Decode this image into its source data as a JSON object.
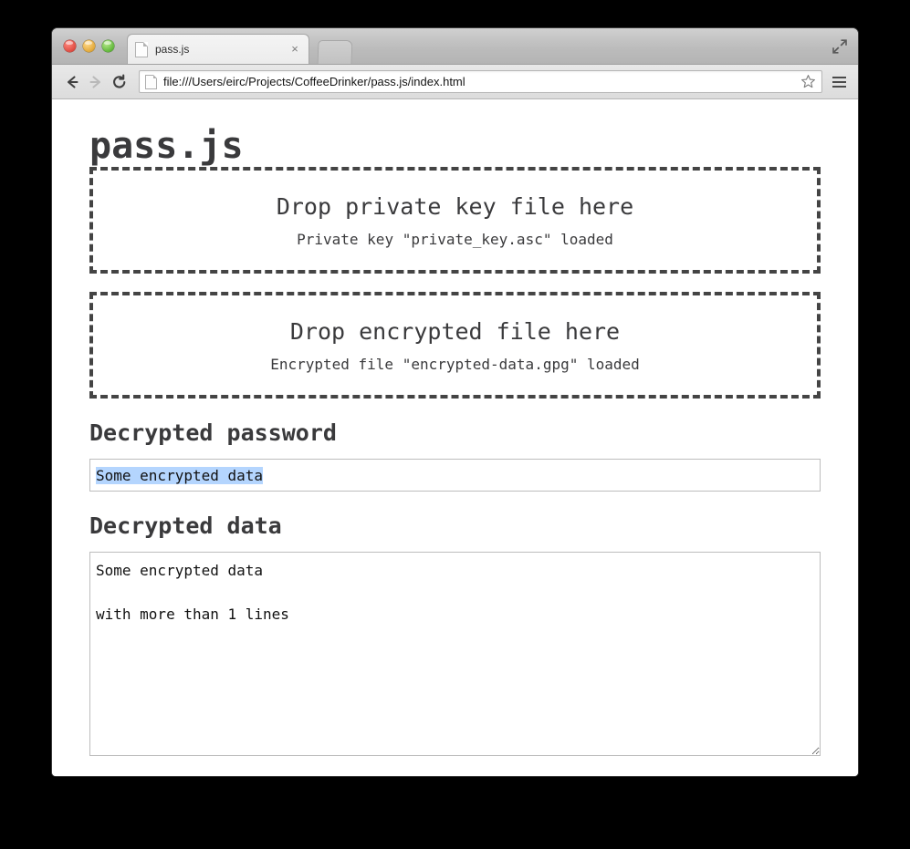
{
  "browser": {
    "window_controls": {
      "close": "close-window",
      "minimize": "minimize-window",
      "maximize": "maximize-window"
    },
    "fullscreen_label": "Enter full screen",
    "tab": {
      "title": "pass.js",
      "close_label": "×"
    },
    "new_tab_label": "New Tab",
    "toolbar": {
      "back_label": "Back",
      "forward_label": "Forward",
      "reload_label": "Reload",
      "url": "file:///Users/eirc/Projects/CoffeeDrinker/pass.js/index.html",
      "bookmark_label": "Bookmark this page",
      "menu_label": "Customize and control"
    }
  },
  "page": {
    "title": "pass.js",
    "dropzones": [
      {
        "heading": "Drop private key file here",
        "status": "Private key \"private_key.asc\" loaded"
      },
      {
        "heading": "Drop encrypted file here",
        "status": "Encrypted file \"encrypted-data.gpg\" loaded"
      }
    ],
    "password_section": {
      "heading": "Decrypted password",
      "value": "Some encrypted data",
      "placeholder": ""
    },
    "data_section": {
      "heading": "Decrypted data",
      "value": "Some encrypted data\n\nwith more than 1 lines",
      "placeholder": ""
    }
  },
  "colors": {
    "selection_highlight": "#b4d5fe",
    "text": "#3a3a3c",
    "dropzone_border": "#444444",
    "page_background": "#ffffff",
    "desktop_background": "#000000"
  }
}
